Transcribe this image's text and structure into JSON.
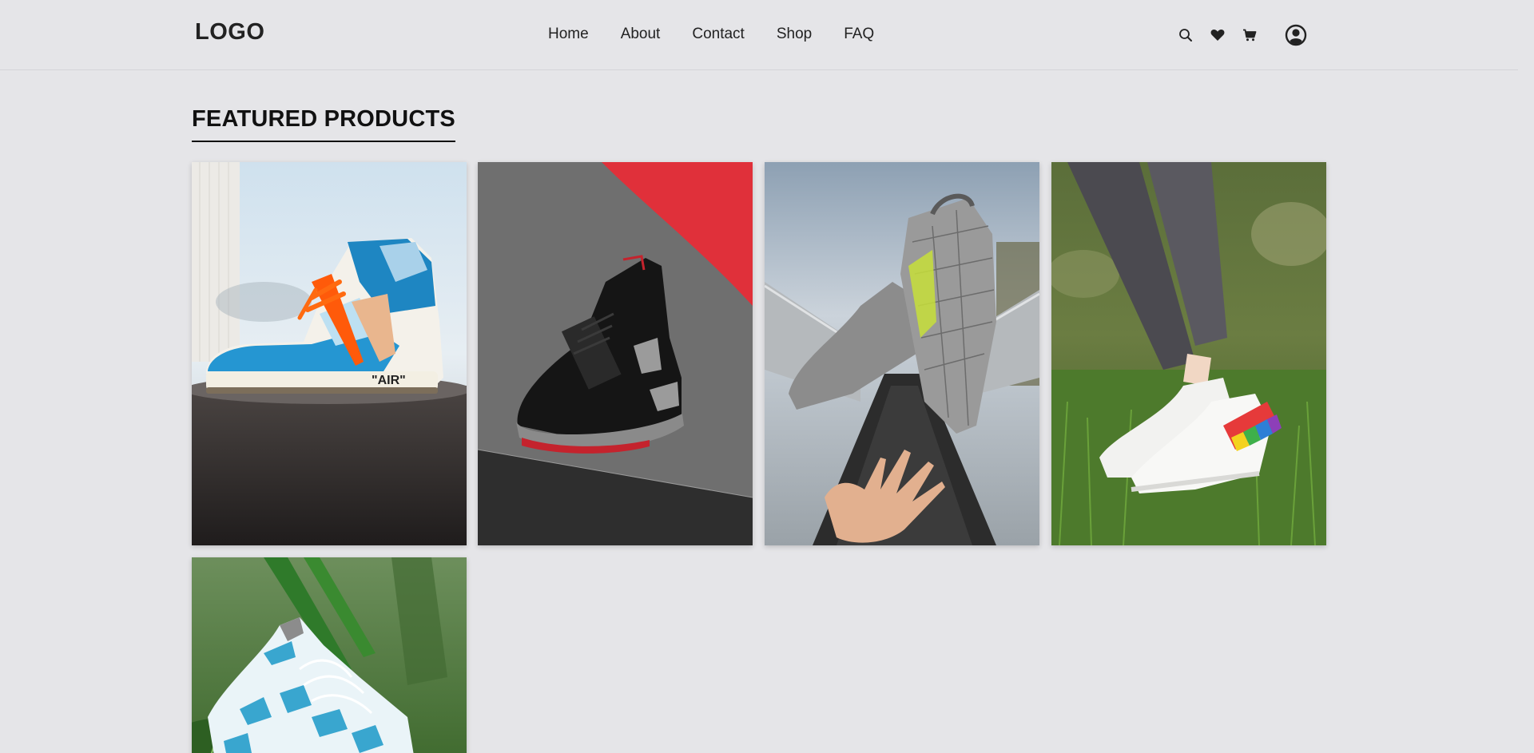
{
  "header": {
    "logo": "LOGO",
    "nav": [
      "Home",
      "About",
      "Contact",
      "Shop",
      "FAQ"
    ],
    "icons": [
      "search-icon",
      "heart-icon",
      "cart-icon",
      "user-icon"
    ]
  },
  "featured": {
    "title": "FEATURED PRODUCTS"
  },
  "products": [
    {
      "name": "product-card-blue-sneaker",
      "print": "\"AIR\""
    },
    {
      "name": "product-card-black-sneaker"
    },
    {
      "name": "product-card-grey-knit-sneaker"
    },
    {
      "name": "product-card-white-rainbow-sneaker"
    },
    {
      "name": "product-card-blue-knit-sneaker"
    }
  ],
  "colors": {
    "background": "#e5e5e8",
    "text": "#1b1b1b",
    "accent_red": "#e0303a"
  }
}
